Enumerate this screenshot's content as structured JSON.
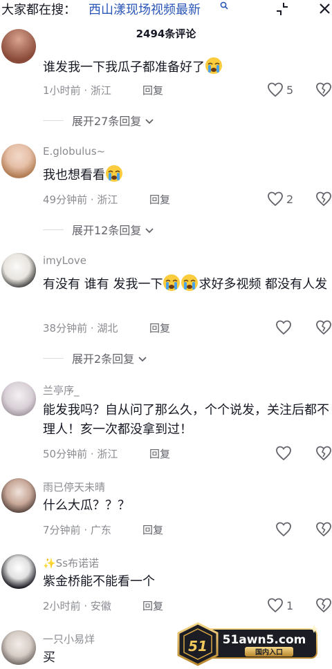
{
  "search": {
    "prefix": "大家都在搜：",
    "query": "西山漾现场视频最新"
  },
  "header": {
    "comment_count": "2494条评论"
  },
  "comments": [
    {
      "username": "",
      "text": "谁发我一下我瓜子都准备好了",
      "time": "1小时前",
      "location": "浙江",
      "reply": "回复",
      "likes": "5",
      "expand": "展开27条回复"
    },
    {
      "username": "E.globulus~",
      "text": "我也想看看",
      "time": "49分钟前",
      "location": "浙江",
      "reply": "回复",
      "likes": "2",
      "expand": "展开12条回复"
    },
    {
      "username": "imyLove",
      "text1": "有没有 谁有 发我一下",
      "text2": "求好多视频 都没有人发",
      "time": "38分钟前",
      "location": "湖北",
      "reply": "回复",
      "likes": "",
      "expand": "展开2条回复"
    },
    {
      "username": "兰亭序_",
      "text": "能发我吗？自从问了那么久，个个说发，关注后都不理人！亥一次都没拿到过！",
      "time": "50分钟前",
      "location": "浙江",
      "reply": "回复",
      "likes": ""
    },
    {
      "username": "雨已停天未晴",
      "text": "什么大瓜？？？",
      "time": "7分钟前",
      "location": "广东",
      "reply": "回复",
      "likes": ""
    },
    {
      "username": "✨Ss布诺诺",
      "text": "紫金桥能不能看一个",
      "time": "2小时前",
      "location": "安徽",
      "reply": "回复",
      "likes": "1"
    },
    {
      "username": "一只小易烊",
      "text": "买"
    }
  ],
  "watermark": {
    "site": "51awn5.com",
    "sub": "国内入口",
    "logo": "51"
  },
  "colors": {
    "link": "#2a56b8",
    "muted": "#8a8b91"
  },
  "icons": {
    "like": "heart-icon",
    "dislike": "broken-heart-icon",
    "emoji": "crying-emoji-icon"
  }
}
